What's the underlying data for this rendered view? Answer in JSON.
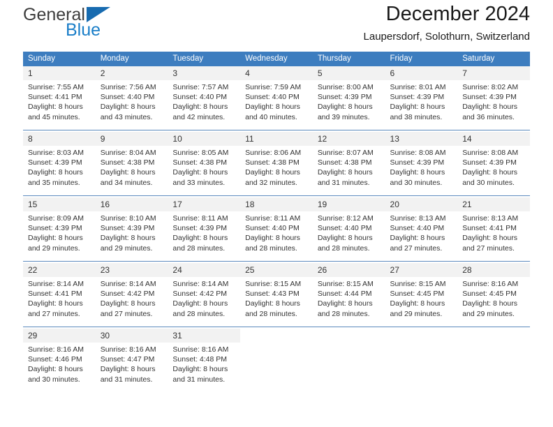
{
  "brand": {
    "line1": "General",
    "line2": "Blue",
    "triangle_color": "#176bb0",
    "line2_color": "#1a7ec8"
  },
  "header": {
    "title": "December 2024",
    "subtitle": "Laupersdorf, Solothurn, Switzerland"
  },
  "theme": {
    "header_bg": "#3d7dbf",
    "header_text": "#ffffff",
    "daynum_bg": "#f2f2f2",
    "cell_bg": "#ffffff",
    "separator": "#5b89bd",
    "text": "#333333"
  },
  "calendar": {
    "weekdays": [
      "Sunday",
      "Monday",
      "Tuesday",
      "Wednesday",
      "Thursday",
      "Friday",
      "Saturday"
    ],
    "weeks": [
      [
        {
          "day": "1",
          "sunrise": "Sunrise: 7:55 AM",
          "sunset": "Sunset: 4:41 PM",
          "daylight1": "Daylight: 8 hours",
          "daylight2": "and 45 minutes."
        },
        {
          "day": "2",
          "sunrise": "Sunrise: 7:56 AM",
          "sunset": "Sunset: 4:40 PM",
          "daylight1": "Daylight: 8 hours",
          "daylight2": "and 43 minutes."
        },
        {
          "day": "3",
          "sunrise": "Sunrise: 7:57 AM",
          "sunset": "Sunset: 4:40 PM",
          "daylight1": "Daylight: 8 hours",
          "daylight2": "and 42 minutes."
        },
        {
          "day": "4",
          "sunrise": "Sunrise: 7:59 AM",
          "sunset": "Sunset: 4:40 PM",
          "daylight1": "Daylight: 8 hours",
          "daylight2": "and 40 minutes."
        },
        {
          "day": "5",
          "sunrise": "Sunrise: 8:00 AM",
          "sunset": "Sunset: 4:39 PM",
          "daylight1": "Daylight: 8 hours",
          "daylight2": "and 39 minutes."
        },
        {
          "day": "6",
          "sunrise": "Sunrise: 8:01 AM",
          "sunset": "Sunset: 4:39 PM",
          "daylight1": "Daylight: 8 hours",
          "daylight2": "and 38 minutes."
        },
        {
          "day": "7",
          "sunrise": "Sunrise: 8:02 AM",
          "sunset": "Sunset: 4:39 PM",
          "daylight1": "Daylight: 8 hours",
          "daylight2": "and 36 minutes."
        }
      ],
      [
        {
          "day": "8",
          "sunrise": "Sunrise: 8:03 AM",
          "sunset": "Sunset: 4:39 PM",
          "daylight1": "Daylight: 8 hours",
          "daylight2": "and 35 minutes."
        },
        {
          "day": "9",
          "sunrise": "Sunrise: 8:04 AM",
          "sunset": "Sunset: 4:38 PM",
          "daylight1": "Daylight: 8 hours",
          "daylight2": "and 34 minutes."
        },
        {
          "day": "10",
          "sunrise": "Sunrise: 8:05 AM",
          "sunset": "Sunset: 4:38 PM",
          "daylight1": "Daylight: 8 hours",
          "daylight2": "and 33 minutes."
        },
        {
          "day": "11",
          "sunrise": "Sunrise: 8:06 AM",
          "sunset": "Sunset: 4:38 PM",
          "daylight1": "Daylight: 8 hours",
          "daylight2": "and 32 minutes."
        },
        {
          "day": "12",
          "sunrise": "Sunrise: 8:07 AM",
          "sunset": "Sunset: 4:38 PM",
          "daylight1": "Daylight: 8 hours",
          "daylight2": "and 31 minutes."
        },
        {
          "day": "13",
          "sunrise": "Sunrise: 8:08 AM",
          "sunset": "Sunset: 4:39 PM",
          "daylight1": "Daylight: 8 hours",
          "daylight2": "and 30 minutes."
        },
        {
          "day": "14",
          "sunrise": "Sunrise: 8:08 AM",
          "sunset": "Sunset: 4:39 PM",
          "daylight1": "Daylight: 8 hours",
          "daylight2": "and 30 minutes."
        }
      ],
      [
        {
          "day": "15",
          "sunrise": "Sunrise: 8:09 AM",
          "sunset": "Sunset: 4:39 PM",
          "daylight1": "Daylight: 8 hours",
          "daylight2": "and 29 minutes."
        },
        {
          "day": "16",
          "sunrise": "Sunrise: 8:10 AM",
          "sunset": "Sunset: 4:39 PM",
          "daylight1": "Daylight: 8 hours",
          "daylight2": "and 29 minutes."
        },
        {
          "day": "17",
          "sunrise": "Sunrise: 8:11 AM",
          "sunset": "Sunset: 4:39 PM",
          "daylight1": "Daylight: 8 hours",
          "daylight2": "and 28 minutes."
        },
        {
          "day": "18",
          "sunrise": "Sunrise: 8:11 AM",
          "sunset": "Sunset: 4:40 PM",
          "daylight1": "Daylight: 8 hours",
          "daylight2": "and 28 minutes."
        },
        {
          "day": "19",
          "sunrise": "Sunrise: 8:12 AM",
          "sunset": "Sunset: 4:40 PM",
          "daylight1": "Daylight: 8 hours",
          "daylight2": "and 28 minutes."
        },
        {
          "day": "20",
          "sunrise": "Sunrise: 8:13 AM",
          "sunset": "Sunset: 4:40 PM",
          "daylight1": "Daylight: 8 hours",
          "daylight2": "and 27 minutes."
        },
        {
          "day": "21",
          "sunrise": "Sunrise: 8:13 AM",
          "sunset": "Sunset: 4:41 PM",
          "daylight1": "Daylight: 8 hours",
          "daylight2": "and 27 minutes."
        }
      ],
      [
        {
          "day": "22",
          "sunrise": "Sunrise: 8:14 AM",
          "sunset": "Sunset: 4:41 PM",
          "daylight1": "Daylight: 8 hours",
          "daylight2": "and 27 minutes."
        },
        {
          "day": "23",
          "sunrise": "Sunrise: 8:14 AM",
          "sunset": "Sunset: 4:42 PM",
          "daylight1": "Daylight: 8 hours",
          "daylight2": "and 27 minutes."
        },
        {
          "day": "24",
          "sunrise": "Sunrise: 8:14 AM",
          "sunset": "Sunset: 4:42 PM",
          "daylight1": "Daylight: 8 hours",
          "daylight2": "and 28 minutes."
        },
        {
          "day": "25",
          "sunrise": "Sunrise: 8:15 AM",
          "sunset": "Sunset: 4:43 PM",
          "daylight1": "Daylight: 8 hours",
          "daylight2": "and 28 minutes."
        },
        {
          "day": "26",
          "sunrise": "Sunrise: 8:15 AM",
          "sunset": "Sunset: 4:44 PM",
          "daylight1": "Daylight: 8 hours",
          "daylight2": "and 28 minutes."
        },
        {
          "day": "27",
          "sunrise": "Sunrise: 8:15 AM",
          "sunset": "Sunset: 4:45 PM",
          "daylight1": "Daylight: 8 hours",
          "daylight2": "and 29 minutes."
        },
        {
          "day": "28",
          "sunrise": "Sunrise: 8:16 AM",
          "sunset": "Sunset: 4:45 PM",
          "daylight1": "Daylight: 8 hours",
          "daylight2": "and 29 minutes."
        }
      ],
      [
        {
          "day": "29",
          "sunrise": "Sunrise: 8:16 AM",
          "sunset": "Sunset: 4:46 PM",
          "daylight1": "Daylight: 8 hours",
          "daylight2": "and 30 minutes."
        },
        {
          "day": "30",
          "sunrise": "Sunrise: 8:16 AM",
          "sunset": "Sunset: 4:47 PM",
          "daylight1": "Daylight: 8 hours",
          "daylight2": "and 31 minutes."
        },
        {
          "day": "31",
          "sunrise": "Sunrise: 8:16 AM",
          "sunset": "Sunset: 4:48 PM",
          "daylight1": "Daylight: 8 hours",
          "daylight2": "and 31 minutes."
        },
        {
          "day": "",
          "sunrise": "",
          "sunset": "",
          "daylight1": "",
          "daylight2": ""
        },
        {
          "day": "",
          "sunrise": "",
          "sunset": "",
          "daylight1": "",
          "daylight2": ""
        },
        {
          "day": "",
          "sunrise": "",
          "sunset": "",
          "daylight1": "",
          "daylight2": ""
        },
        {
          "day": "",
          "sunrise": "",
          "sunset": "",
          "daylight1": "",
          "daylight2": ""
        }
      ]
    ]
  }
}
